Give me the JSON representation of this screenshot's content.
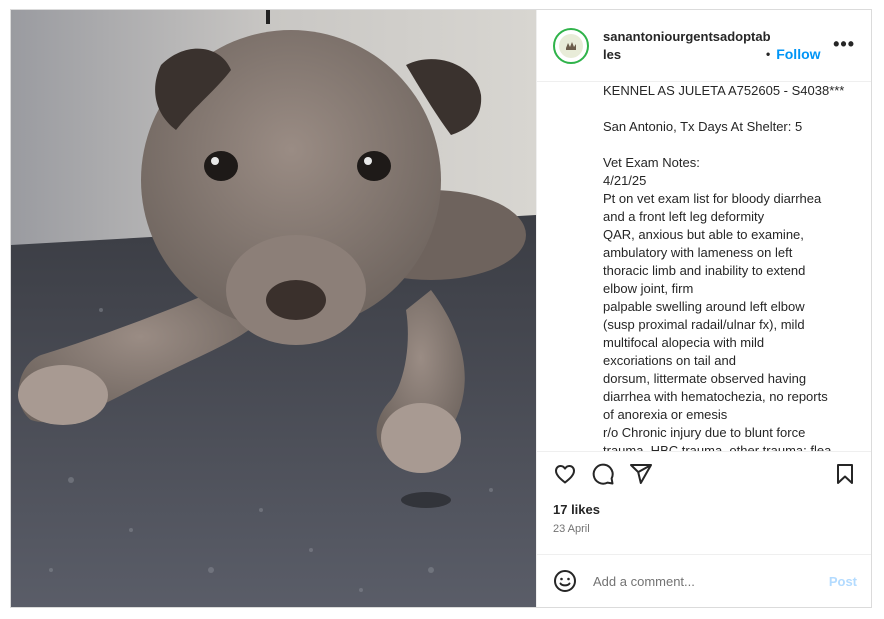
{
  "post": {
    "username": "sanantoniourgentsadoptables",
    "follow_label": "Follow",
    "more_label": "•••",
    "image_alt": "Grey puppy lying on a shelter floor",
    "caption": "KENNEL AS JULETA A752605 - S4038***\n\nSan Antonio, Tx Days At Shelter: 5\n\nVet Exam Notes:\n4/21/25\nPt on vet exam list for bloody diarrhea\nand a front left leg deformity\nQAR, anxious but able to examine,\nambulatory with lameness on left\nthoracic limb and inability to extend\nelbow joint, firm\npalpable swelling around left elbow\n(susp proximal radail/ulnar fx), mild\nmultifocal alopecia with mild\nexcoriations on tail and\ndorsum, littermate observed having\ndiarrhea with hematochezia, no reports\nof anorexia or emesis\nr/o Chronic injury due to blunt force\ntrauma, HBC trauma, other trauma; flea",
    "likes": "17 likes",
    "date": "23 April",
    "comment_placeholder": "Add a comment...",
    "post_label": "Post"
  },
  "icons": {
    "like": "heart-icon",
    "comment": "comment-icon",
    "share": "share-icon",
    "save": "bookmark-icon",
    "emoji": "emoji-icon",
    "more": "more-icon"
  },
  "colors": {
    "accent": "#0095f6",
    "text": "#262626",
    "muted": "#737373",
    "post_disabled": "#b3dbff"
  }
}
